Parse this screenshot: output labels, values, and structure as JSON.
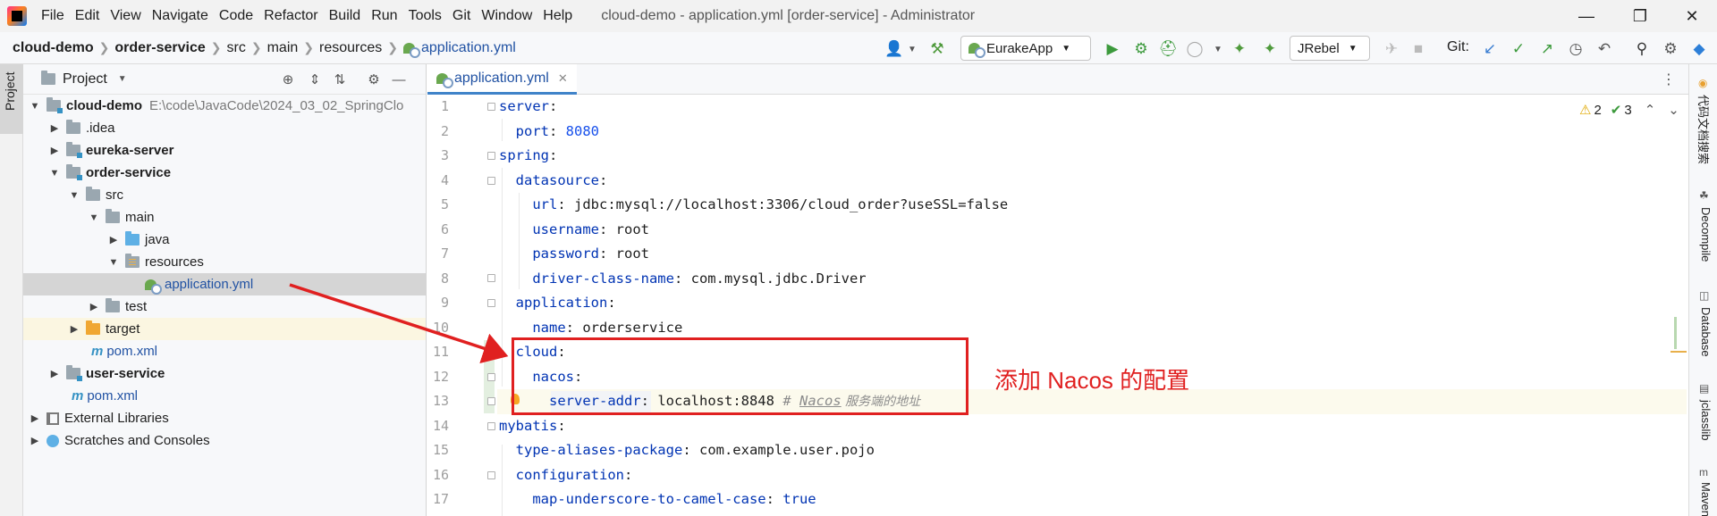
{
  "titlebar": {
    "menu": [
      "File",
      "Edit",
      "View",
      "Navigate",
      "Code",
      "Refactor",
      "Build",
      "Run",
      "Tools",
      "Git",
      "Window",
      "Help"
    ],
    "title": "cloud-demo - application.yml [order-service] - Administrator",
    "controls": [
      "minimize-icon",
      "restore-icon",
      "close-icon"
    ]
  },
  "breadcrumb": [
    "cloud-demo",
    "order-service",
    "src",
    "main",
    "resources",
    "application.yml"
  ],
  "toolbar": {
    "run_config": "EurakeApp",
    "jrebel": "JRebel",
    "git_label": "Git:",
    "icons": [
      "user-icon",
      "hammer-icon",
      "run-icon",
      "debug-icon",
      "coverage-icon",
      "profile-icon",
      "jrebel-run-icon",
      "jrebel-debug-icon",
      "stop-icon",
      "git-update-icon",
      "git-commit-icon",
      "git-push-icon",
      "history-icon",
      "rollback-icon",
      "search-icon",
      "settings-icon"
    ]
  },
  "left_strip": {
    "tab": "Project"
  },
  "project": {
    "title": "Project",
    "tree": [
      {
        "label": "cloud-demo",
        "path": "E:\\code\\JavaCode\\2024_03_02_SpringClo",
        "bold": true
      },
      {
        "label": ".idea"
      },
      {
        "label": "eureka-server",
        "bold": true
      },
      {
        "label": "order-service",
        "bold": true
      },
      {
        "label": "src"
      },
      {
        "label": "main"
      },
      {
        "label": "java"
      },
      {
        "label": "resources"
      },
      {
        "label": "application.yml"
      },
      {
        "label": "test"
      },
      {
        "label": "target"
      },
      {
        "label": "pom.xml"
      },
      {
        "label": "user-service",
        "bold": true
      },
      {
        "label": "pom.xml"
      },
      {
        "label": "External Libraries"
      },
      {
        "label": "Scratches and Consoles"
      }
    ]
  },
  "editor": {
    "tab": "application.yml",
    "warnings": "2",
    "checks": "3",
    "line_numbers": [
      "1",
      "2",
      "3",
      "4",
      "5",
      "6",
      "7",
      "8",
      "9",
      "10",
      "11",
      "12",
      "13",
      "14",
      "15",
      "16",
      "17"
    ],
    "lines": [
      {
        "key": "server",
        "sep": ":",
        "val": ""
      },
      {
        "key": "port",
        "sep": ": ",
        "val": "8080"
      },
      {
        "key": "spring",
        "sep": ":",
        "val": ""
      },
      {
        "key": "datasource",
        "sep": ":",
        "val": ""
      },
      {
        "key": "url",
        "sep": ": ",
        "val": "jdbc:mysql://localhost:3306/cloud_order?useSSL=false"
      },
      {
        "key": "username",
        "sep": ": ",
        "val": "root"
      },
      {
        "key": "password",
        "sep": ": ",
        "val": "root"
      },
      {
        "key": "driver-class-name",
        "sep": ": ",
        "val": "com.mysql.jdbc.Driver"
      },
      {
        "key": "application",
        "sep": ":",
        "val": ""
      },
      {
        "key": "name",
        "sep": ": ",
        "val": "orderservice"
      },
      {
        "key": "cloud",
        "sep": ":",
        "val": ""
      },
      {
        "key": "nacos",
        "sep": ":",
        "val": ""
      },
      {
        "key": "server-addr",
        "sep": ": ",
        "val": "localhost:8848",
        "comment_prefix": "# ",
        "comment_word": "Nacos",
        "comment_rest": " 服务端的地址"
      },
      {
        "key": "mybatis",
        "sep": ":",
        "val": ""
      },
      {
        "key": "type-aliases-package",
        "sep": ": ",
        "val": "com.example.user.pojo"
      },
      {
        "key": "configuration",
        "sep": ":",
        "val": ""
      },
      {
        "key": "map-underscore-to-camel-case",
        "sep": ": ",
        "val": "true"
      }
    ]
  },
  "annotation": "添加 Nacos 的配置",
  "right_strip": [
    "代码文档搜索",
    "Decompile",
    "Database",
    "jclasslib",
    "Maven"
  ],
  "colors": {
    "annotation_red": "#e02020",
    "yaml_key": "#0033b3",
    "selection": "#d5d5d5"
  }
}
